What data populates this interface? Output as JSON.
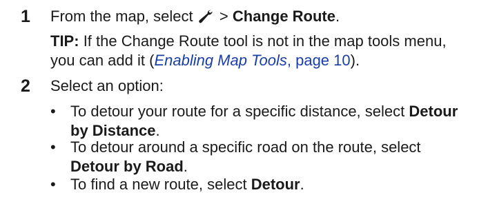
{
  "steps": [
    {
      "number": "1",
      "prefix": "From the map, select",
      "icon": "wrench-icon",
      "separator": ">",
      "action": "Change Route",
      "suffix": ".",
      "tip": {
        "label": "TIP:",
        "line1": "If the Change Route tool is not in the map tools menu,",
        "line2_prefix": "you can add it (",
        "link_text": "Enabling Map Tools",
        "link_page": ", page 10",
        "line2_suffix": ")."
      }
    },
    {
      "number": "2",
      "text": "Select an option:",
      "bullets": [
        {
          "bullet": "•",
          "line1": "To detour your route for a specific distance, select",
          "bold1": "Detour",
          "bold2": "by Distance",
          "end": "."
        },
        {
          "bullet": "•",
          "line1": "To detour around a specific road on the route, select",
          "bold1": "Detour by Road",
          "end": "."
        },
        {
          "bullet": "•",
          "line1": "To find a new route, select",
          "bold1": "Detour",
          "end": "."
        }
      ]
    }
  ]
}
